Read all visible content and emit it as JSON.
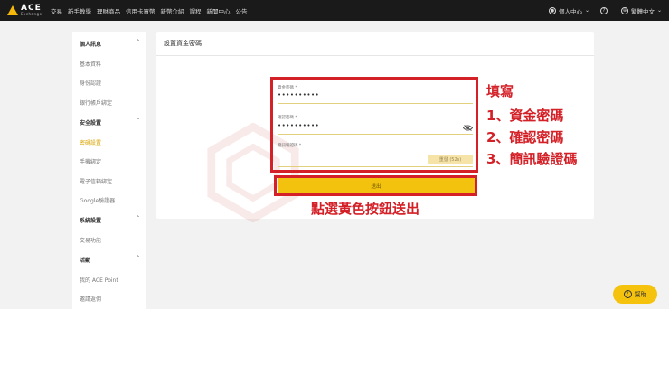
{
  "header": {
    "logo": {
      "name": "ACE",
      "sub": "Exchange"
    },
    "nav": [
      "交易",
      "新手教學",
      "理財商品",
      "信用卡買幣",
      "新幣介紹",
      "課程",
      "新聞中心",
      "公告"
    ],
    "account_label": "個人中心",
    "language_label": "繁體中文"
  },
  "sidebar": {
    "sections": [
      {
        "title": "個人訊息",
        "items": [
          "基本資料",
          "身份認證",
          "銀行帳戶綁定"
        ]
      },
      {
        "title": "安全設置",
        "items": [
          "密碼設置",
          "手機綁定",
          "電子信箱綁定",
          "Google驗證器"
        ]
      },
      {
        "title": "系統設置",
        "items": [
          "交易功能"
        ]
      },
      {
        "title": "活動",
        "items": [
          "我的 ACE Point",
          "邀請返佣"
        ]
      }
    ],
    "active_item": "密碼設置"
  },
  "panel": {
    "title": "設置資金密碼",
    "fields": [
      {
        "label": "資金密碼 *",
        "value": "••••••••••"
      },
      {
        "label": "確認密碼 *",
        "value": "••••••••••"
      },
      {
        "label": "簡訊驗證碼 *",
        "value": ""
      }
    ],
    "resend_label": "重發 (52s)",
    "submit_label": "送出"
  },
  "annotations": {
    "fill_title": "填寫",
    "steps": [
      "1、資金密碼",
      "2、確認密碼",
      "3、簡訊驗證碼"
    ],
    "click_note": "點選黃色按鈕送出"
  },
  "help": {
    "label": "幫助"
  },
  "colors": {
    "accent": "#f3c20f",
    "annotation": "#d42027",
    "topbar": "#1a1a1a"
  }
}
